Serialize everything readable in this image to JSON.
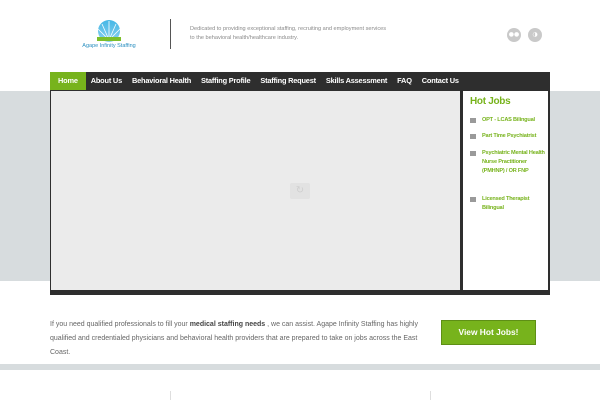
{
  "header": {
    "logo_text": "Agape Infinity Staffing",
    "tagline": "Dedicated to providing exceptional staffing, recruiting and employment services to the behavioral health/healthcare industry.",
    "social": [
      {
        "icon": "rss-alt-icon",
        "glyph": "●●"
      },
      {
        "icon": "rss-icon",
        "glyph": "◑"
      }
    ]
  },
  "nav": {
    "items": [
      {
        "label": "Home",
        "active": true
      },
      {
        "label": "About Us"
      },
      {
        "label": "Behavioral Health"
      },
      {
        "label": "Staffing Profile"
      },
      {
        "label": "Staffing Request"
      },
      {
        "label": "Skills Assessment"
      },
      {
        "label": "FAQ"
      },
      {
        "label": "Contact Us"
      }
    ]
  },
  "hot_jobs": {
    "title": "Hot Jobs",
    "jobs": [
      {
        "label": "OPT - LCAS Bilingual"
      },
      {
        "label": "Part Time Psychiatrist"
      },
      {
        "label": "Psychiatric Mental Health Nurse Practitioner (PMHNP) / OR FNP"
      },
      {
        "label": "Licensed Therapist Bilingual"
      }
    ]
  },
  "intro": {
    "part1": "If you need qualified professionals to fill your",
    "highlight": "medical staffing needs",
    "part2": ", we can assist. Agape Infinity Staffing  has highly qualified and credentialed physicians and behavioral health providers that are prepared to take on jobs across the East Coast."
  },
  "cta": {
    "label": "View Hot Jobs!"
  },
  "colors": {
    "accent": "#77b31c",
    "nav_bg": "#2e2e2e",
    "band": "#d7dcde",
    "logo": "#2a8fc0"
  }
}
